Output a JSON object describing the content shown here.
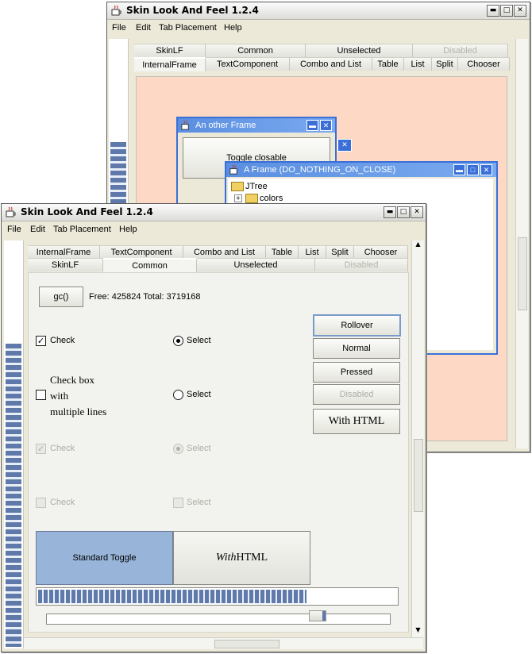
{
  "window_back": {
    "title": "Skin Look And Feel 1.2.4",
    "menu": [
      "File",
      "Edit",
      "Tab Placement",
      "Help"
    ],
    "tabs_row1": [
      "SkinLF",
      "Common",
      "Unselected",
      "Disabled"
    ],
    "tabs_row2": [
      "InternalFrame",
      "TextComponent",
      "Combo and List",
      "Table",
      "List",
      "Split",
      "Chooser"
    ],
    "frame_other": {
      "title": "An other Frame",
      "toggle_label": "Toggle closable"
    },
    "frame_main": {
      "title": "A Frame (DO_NOTHING_ON_CLOSE)",
      "tree": [
        "JTree",
        "colors"
      ]
    }
  },
  "window_front": {
    "title": "Skin Look And Feel 1.2.4",
    "menu": [
      "File",
      "Edit",
      "Tab Placement",
      "Help"
    ],
    "tabs_row1": [
      "InternalFrame",
      "TextComponent",
      "Combo and List",
      "Table",
      "List",
      "Split",
      "Chooser"
    ],
    "tabs_row2": [
      "SkinLF",
      "Common",
      "Unselected",
      "Disabled"
    ],
    "gc_button": "gc()",
    "memory_text": "Free: 425824 Total: 3719168",
    "check_label": "Check",
    "select_label": "Select",
    "multiline_check": [
      "Check box",
      "with",
      "multiple lines"
    ],
    "buttons": [
      "Rollover",
      "Normal",
      "Pressed",
      "Disabled"
    ],
    "with_html_button": "With HTML",
    "toggle_standard": "Standard Toggle",
    "toggle_html_italic": "With",
    "toggle_html_plain": "HTML",
    "progress_value": 0.75,
    "slider_value": 0.8
  },
  "colors": {
    "desktop_bg": "#fdd8c4",
    "frame_border": "#3a6fd8",
    "toggle_pressed": "#98b4d8",
    "progress": "#5f7aaa"
  }
}
